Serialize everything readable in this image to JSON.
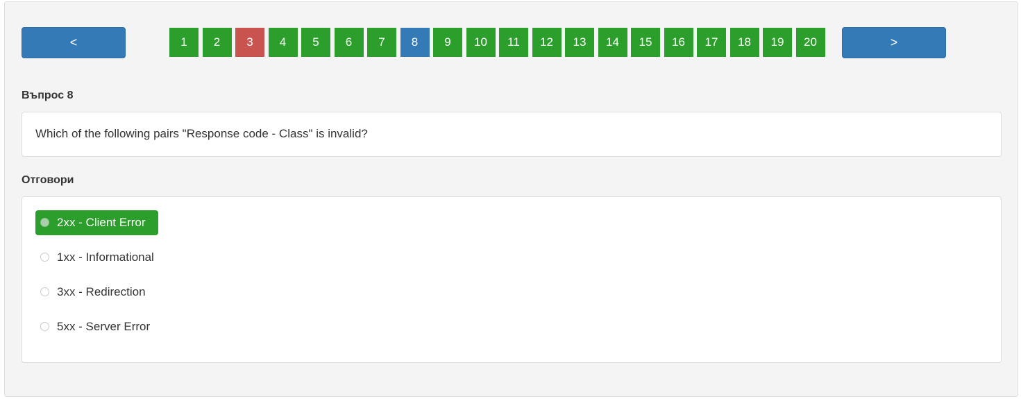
{
  "navigation": {
    "prev_label": "<",
    "next_label": ">"
  },
  "pager": {
    "current": 8,
    "pages": [
      {
        "label": "1",
        "status": "answered"
      },
      {
        "label": "2",
        "status": "answered"
      },
      {
        "label": "3",
        "status": "wrong"
      },
      {
        "label": "4",
        "status": "answered"
      },
      {
        "label": "5",
        "status": "answered"
      },
      {
        "label": "6",
        "status": "answered"
      },
      {
        "label": "7",
        "status": "answered"
      },
      {
        "label": "8",
        "status": "current"
      },
      {
        "label": "9",
        "status": "answered"
      },
      {
        "label": "10",
        "status": "answered"
      },
      {
        "label": "11",
        "status": "answered"
      },
      {
        "label": "12",
        "status": "answered"
      },
      {
        "label": "13",
        "status": "answered"
      },
      {
        "label": "14",
        "status": "answered"
      },
      {
        "label": "15",
        "status": "answered"
      },
      {
        "label": "16",
        "status": "answered"
      },
      {
        "label": "17",
        "status": "answered"
      },
      {
        "label": "18",
        "status": "answered"
      },
      {
        "label": "19",
        "status": "answered"
      },
      {
        "label": "20",
        "status": "answered"
      }
    ]
  },
  "colors": {
    "answered": "#2c9e2c",
    "wrong": "#c9534f",
    "current": "#337ab7",
    "nav_button": "#337ab7",
    "selected_answer": "#2c9e2c"
  },
  "question": {
    "heading": "Въпрос 8",
    "text": "Which of the following pairs \"Response code - Class\" is invalid?"
  },
  "answers": {
    "heading": "Отговори",
    "options": [
      {
        "label": "2xx - Client Error",
        "selected": true
      },
      {
        "label": "1xx - Informational",
        "selected": false
      },
      {
        "label": "3xx - Redirection",
        "selected": false
      },
      {
        "label": "5xx - Server Error",
        "selected": false
      }
    ]
  }
}
